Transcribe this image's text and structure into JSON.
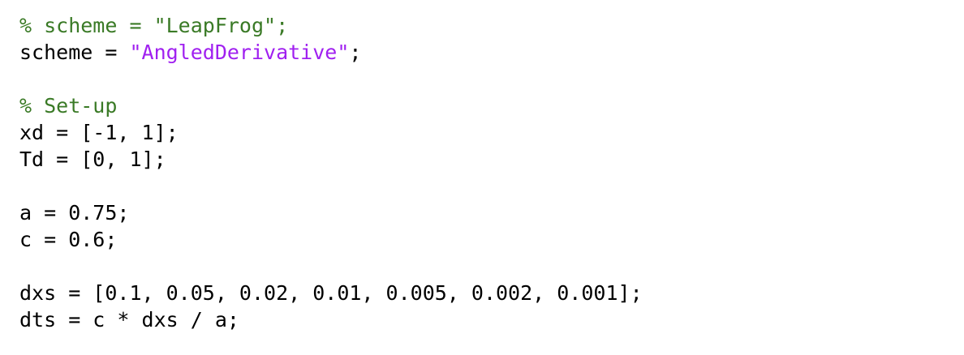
{
  "editor": {
    "colors": {
      "comment": "#3a7a26",
      "string": "#a020f0",
      "plain": "#000000",
      "background": "#ffffff"
    },
    "lines": [
      [
        {
          "type": "comment",
          "text": "% scheme = \"LeapFrog\";"
        }
      ],
      [
        {
          "type": "plain",
          "text": "scheme = "
        },
        {
          "type": "string",
          "text": "\"AngledDerivative\""
        },
        {
          "type": "plain",
          "text": ";"
        }
      ],
      [],
      [
        {
          "type": "comment",
          "text": "% Set-up"
        }
      ],
      [
        {
          "type": "plain",
          "text": "xd = [-1, 1];"
        }
      ],
      [
        {
          "type": "plain",
          "text": "Td = [0, 1];"
        }
      ],
      [],
      [
        {
          "type": "plain",
          "text": "a = 0.75;"
        }
      ],
      [
        {
          "type": "plain",
          "text": "c = 0.6;"
        }
      ],
      [],
      [
        {
          "type": "plain",
          "text": "dxs = [0.1, 0.05, 0.02, 0.01, 0.005, 0.002, 0.001];"
        }
      ],
      [
        {
          "type": "plain",
          "text": "dts = c * dxs / a;"
        }
      ]
    ]
  }
}
